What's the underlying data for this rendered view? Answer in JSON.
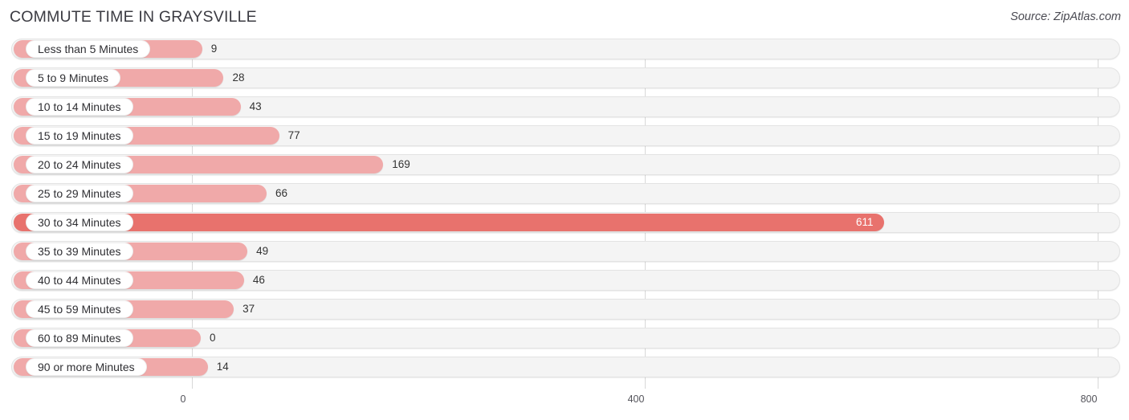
{
  "header": {
    "title": "COMMUTE TIME IN GRAYSVILLE",
    "source": "Source: ZipAtlas.com"
  },
  "chart_data": {
    "type": "bar",
    "orientation": "horizontal",
    "title": "COMMUTE TIME IN GRAYSVILLE",
    "subtitle": "Source: ZipAtlas.com",
    "xlabel": "",
    "ylabel": "",
    "xlim": [
      0,
      800
    ],
    "xticks": [
      0,
      400,
      800
    ],
    "xtick_labels": [
      "0",
      "400",
      "800"
    ],
    "grid": true,
    "legend": false,
    "highlight_category": "30 to 34 Minutes",
    "colors": {
      "bar": "#f0a9a9",
      "bar_highlight": "#e8726d",
      "track": "#f4f4f4",
      "track_border": "#e3e3e3",
      "pill_background": "#ffffff",
      "text": "#333333",
      "gridline": "#d8d8d8"
    },
    "categories": [
      "Less than 5 Minutes",
      "5 to 9 Minutes",
      "10 to 14 Minutes",
      "15 to 19 Minutes",
      "20 to 24 Minutes",
      "25 to 29 Minutes",
      "30 to 34 Minutes",
      "35 to 39 Minutes",
      "40 to 44 Minutes",
      "45 to 59 Minutes",
      "60 to 89 Minutes",
      "90 or more Minutes"
    ],
    "values": [
      9,
      28,
      43,
      77,
      169,
      66,
      611,
      49,
      46,
      37,
      0,
      14
    ],
    "value_labels": [
      "9",
      "28",
      "43",
      "77",
      "169",
      "66",
      "611",
      "49",
      "46",
      "37",
      "0",
      "14"
    ]
  },
  "rows": [
    {
      "label": "Less than 5 Minutes",
      "value": 9,
      "value_label": "9",
      "highlight": false
    },
    {
      "label": "5 to 9 Minutes",
      "value": 28,
      "value_label": "28",
      "highlight": false
    },
    {
      "label": "10 to 14 Minutes",
      "value": 43,
      "value_label": "43",
      "highlight": false
    },
    {
      "label": "15 to 19 Minutes",
      "value": 77,
      "value_label": "77",
      "highlight": false
    },
    {
      "label": "20 to 24 Minutes",
      "value": 169,
      "value_label": "169",
      "highlight": false
    },
    {
      "label": "25 to 29 Minutes",
      "value": 66,
      "value_label": "66",
      "highlight": false
    },
    {
      "label": "30 to 34 Minutes",
      "value": 611,
      "value_label": "611",
      "highlight": true
    },
    {
      "label": "35 to 39 Minutes",
      "value": 49,
      "value_label": "49",
      "highlight": false
    },
    {
      "label": "40 to 44 Minutes",
      "value": 46,
      "value_label": "46",
      "highlight": false
    },
    {
      "label": "45 to 59 Minutes",
      "value": 37,
      "value_label": "37",
      "highlight": false
    },
    {
      "label": "60 to 89 Minutes",
      "value": 0,
      "value_label": "0",
      "highlight": false
    },
    {
      "label": "90 or more Minutes",
      "value": 14,
      "value_label": "14",
      "highlight": false
    }
  ],
  "axis": {
    "ticks": [
      {
        "label": "0",
        "value": 0
      },
      {
        "label": "400",
        "value": 400
      },
      {
        "label": "800",
        "value": 800
      }
    ]
  }
}
